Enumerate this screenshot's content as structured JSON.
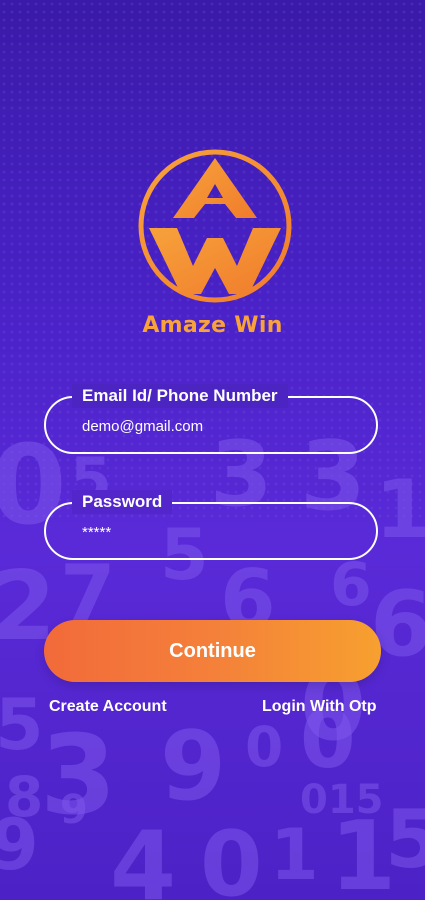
{
  "brand": {
    "logo_icon": "amaze-win-a-w-logo",
    "name": "Amaze Win",
    "primary_color": "#f7a23b",
    "accent_color": "#f26a3a"
  },
  "form": {
    "email": {
      "label": "Email Id/ Phone Number",
      "value": "demo@gmail.com"
    },
    "password": {
      "label": "Password",
      "value": "*****"
    },
    "continue_label": "Continue"
  },
  "links": {
    "create_account": "Create Account",
    "login_with_otp": "Login With Otp"
  },
  "background": {
    "top_color": "#3a1aa8",
    "bottom_color": "#5a2ad8"
  }
}
